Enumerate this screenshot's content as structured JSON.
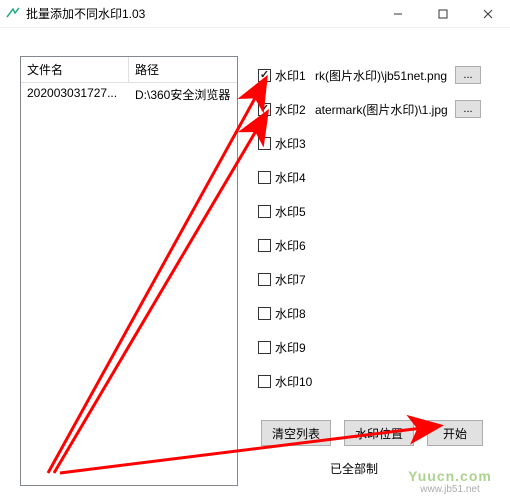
{
  "window": {
    "title": "批量添加不同水印1.03"
  },
  "filelist": {
    "headers": {
      "name": "文件名",
      "path": "路径"
    },
    "rows": [
      {
        "name": "202003031727...",
        "path": "D:\\360安全浏览器"
      }
    ]
  },
  "watermarks": [
    {
      "checked": true,
      "label": "水印1",
      "path": "rk(图片水印)\\jb51net.png",
      "has_browse": true
    },
    {
      "checked": true,
      "label": "水印2",
      "path": "atermark(图片水印)\\1.jpg",
      "has_browse": true
    },
    {
      "checked": false,
      "label": "水印3",
      "path": "",
      "has_browse": false
    },
    {
      "checked": false,
      "label": "水印4",
      "path": "",
      "has_browse": false
    },
    {
      "checked": false,
      "label": "水印5",
      "path": "",
      "has_browse": false
    },
    {
      "checked": false,
      "label": "水印6",
      "path": "",
      "has_browse": false
    },
    {
      "checked": false,
      "label": "水印7",
      "path": "",
      "has_browse": false
    },
    {
      "checked": false,
      "label": "水印8",
      "path": "",
      "has_browse": false
    },
    {
      "checked": false,
      "label": "水印9",
      "path": "",
      "has_browse": false
    },
    {
      "checked": false,
      "label": "水印10",
      "path": "",
      "has_browse": false
    }
  ],
  "buttons": {
    "clear": "清空列表",
    "position": "水印位置",
    "start": "开始",
    "browse": "..."
  },
  "status": "已全部制",
  "footer": {
    "line1": "Yuucn.com",
    "line2": "www.jb51.net"
  }
}
